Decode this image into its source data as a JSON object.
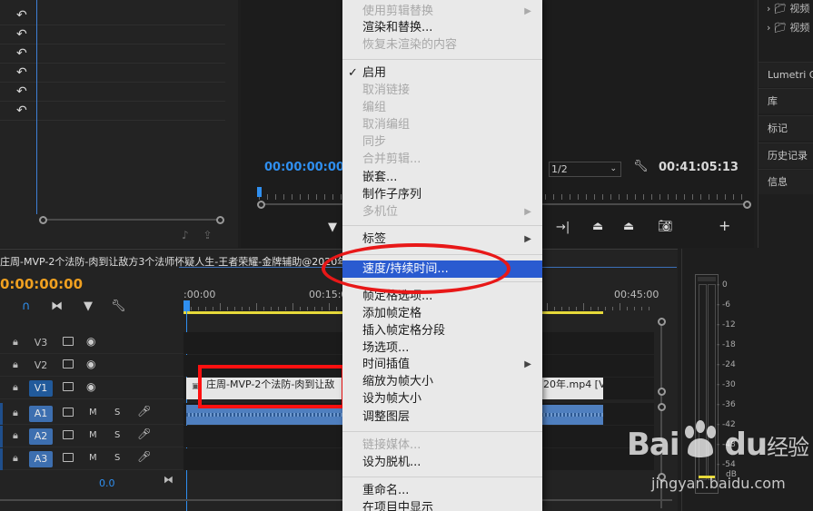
{
  "context_menu": {
    "items": [
      {
        "label": "使用剪辑替换",
        "disabled": true,
        "submenu": true
      },
      {
        "label": "渲染和替换...",
        "disabled": false
      },
      {
        "label": "恢复未渲染的内容",
        "disabled": true
      },
      {
        "label": "启用",
        "disabled": false,
        "checked": true
      },
      {
        "label": "取消链接",
        "disabled": true
      },
      {
        "label": "编组",
        "disabled": true
      },
      {
        "label": "取消编组",
        "disabled": true
      },
      {
        "label": "同步",
        "disabled": true
      },
      {
        "label": "合并剪辑...",
        "disabled": true
      },
      {
        "label": "嵌套...",
        "disabled": false
      },
      {
        "label": "制作子序列",
        "disabled": false
      },
      {
        "label": "多机位",
        "disabled": true,
        "submenu": true
      },
      {
        "label": "标签",
        "disabled": false,
        "submenu": true
      },
      {
        "label": "速度/持续时间...",
        "disabled": false,
        "selected": true
      },
      {
        "label": "帧定格选项...",
        "disabled": false
      },
      {
        "label": "添加帧定格",
        "disabled": false
      },
      {
        "label": "插入帧定格分段",
        "disabled": false
      },
      {
        "label": "场选项...",
        "disabled": false
      },
      {
        "label": "时间插值",
        "disabled": false,
        "submenu": true
      },
      {
        "label": "缩放为帧大小",
        "disabled": false
      },
      {
        "label": "设为帧大小",
        "disabled": false
      },
      {
        "label": "调整图层",
        "disabled": false
      },
      {
        "label": "链接媒体...",
        "disabled": true
      },
      {
        "label": "设为脱机...",
        "disabled": false
      },
      {
        "label": "重命名...",
        "disabled": false
      },
      {
        "label": "在项目中显示",
        "disabled": false
      }
    ]
  },
  "program_monitor": {
    "timecode_left": "00:00:00:00",
    "scale": "1/2",
    "timecode_right": "00:41:05:13"
  },
  "right_panel": {
    "project_items": [
      "视频",
      "视频"
    ],
    "panels": [
      "Lumetri C",
      "库",
      "标记",
      "历史记录",
      "信息"
    ]
  },
  "timeline": {
    "sequence_title": "庄周-MVP-2个法防-肉到让敌方3个法师怀疑人生-王者荣耀-金牌辅助@2020年",
    "timecode": "0:00:00:00",
    "ruler_labels": [
      ":00:00",
      "00:15:0",
      "00:45:00"
    ],
    "tracks": [
      {
        "name": "V3",
        "type": "video",
        "active": false
      },
      {
        "name": "V2",
        "type": "video",
        "active": false
      },
      {
        "name": "V1",
        "type": "video",
        "active": true
      },
      {
        "name": "A1",
        "type": "audio",
        "active": true
      },
      {
        "name": "A2",
        "type": "audio",
        "active": true
      },
      {
        "name": "A3",
        "type": "audio",
        "active": true
      }
    ],
    "clip_label_left": "庄周-MVP-2个法防-肉到让敌",
    "clip_label_right": "20年.mp4 [V",
    "bottom_value": "0.0",
    "playhead_fraction": 0.0
  },
  "meter": {
    "scale": [
      "0",
      "-6",
      "-12",
      "-18",
      "-24",
      "-30",
      "-36",
      "-42",
      "-48",
      "-54"
    ],
    "unit": "dB"
  },
  "watermark": {
    "brand": "Baidu经验",
    "url": "jingyan.baidu.com"
  },
  "colors": {
    "accent_blue": "#2f8ff0",
    "menu_selected": "#2a5bd0",
    "highlight_red": "#e81818",
    "timecode_orange": "#f0a020",
    "work_area_yellow": "#e6d93a"
  }
}
